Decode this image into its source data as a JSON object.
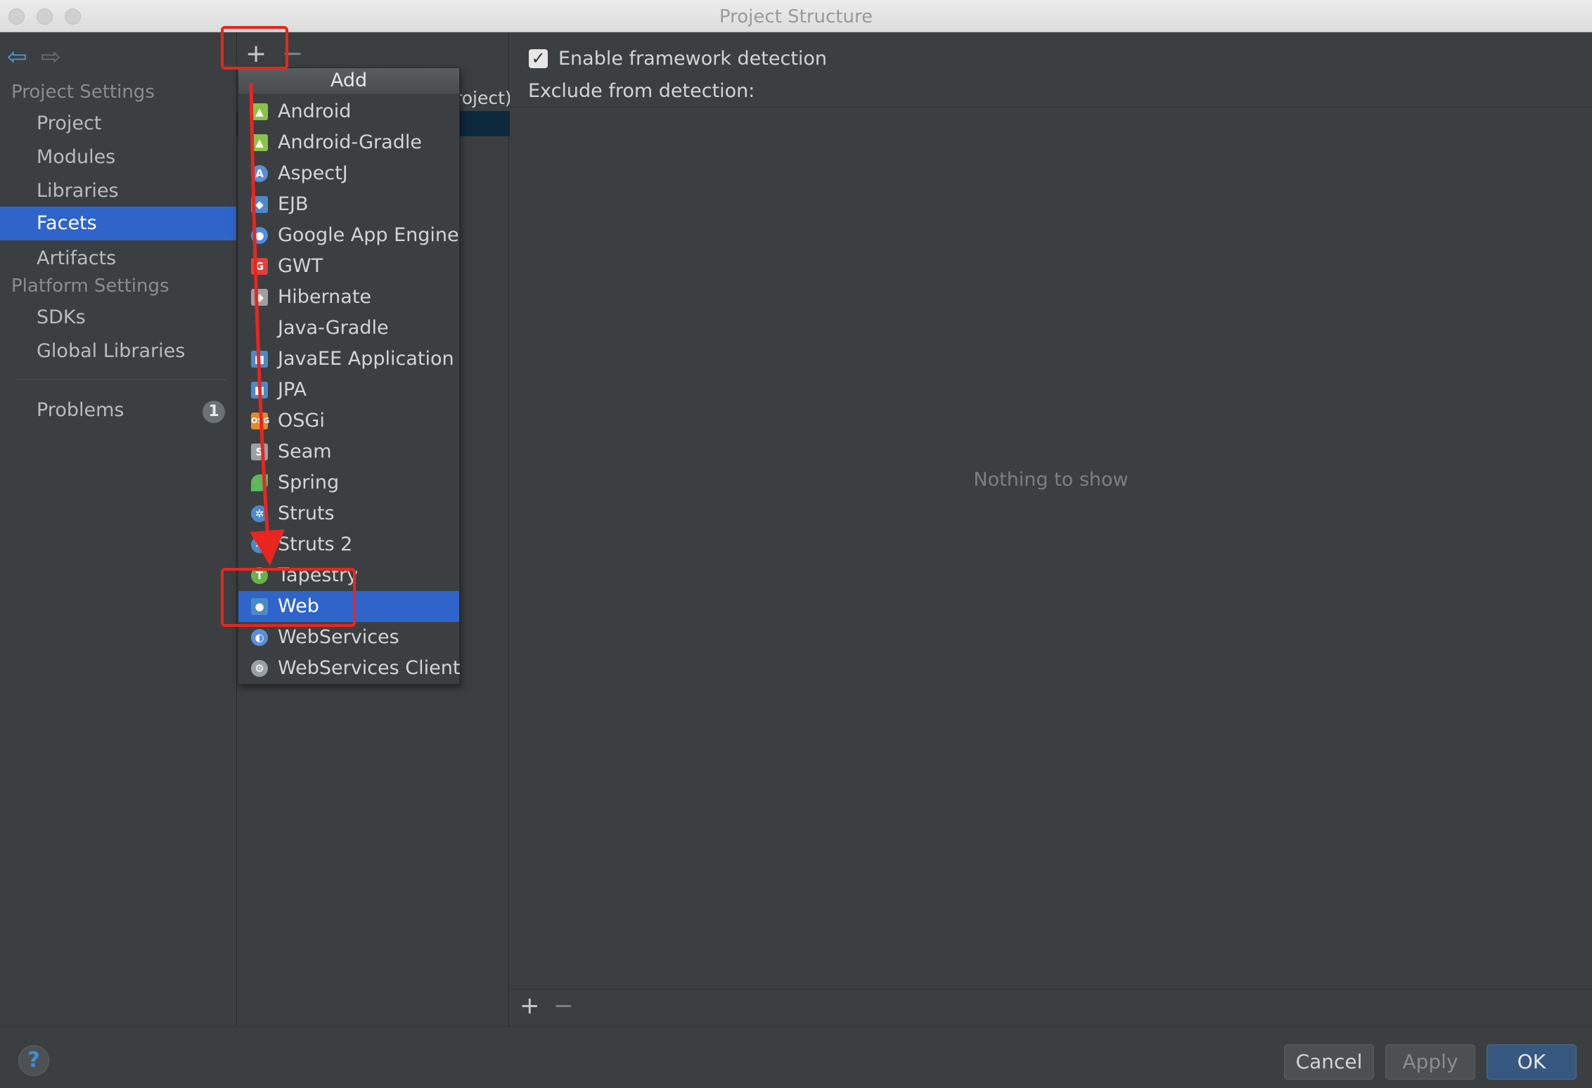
{
  "window": {
    "title": "Project Structure"
  },
  "sidebar": {
    "project_settings_header": "Project Settings",
    "platform_settings_header": "Platform Settings",
    "items": [
      {
        "label": "Project"
      },
      {
        "label": "Modules"
      },
      {
        "label": "Libraries"
      },
      {
        "label": "Facets"
      },
      {
        "label": "Artifacts"
      },
      {
        "label": "SDKs"
      },
      {
        "label": "Global Libraries"
      },
      {
        "label": "Problems"
      }
    ],
    "selected": "Facets",
    "problems_count": "1"
  },
  "middle": {
    "add_icon": "+",
    "remove_icon": "−",
    "visible_row_text": "roject)"
  },
  "popup": {
    "header": "Add",
    "items": [
      {
        "label": "Android",
        "icon": "android-icon",
        "color": "#8bc34a"
      },
      {
        "label": "Android-Gradle",
        "icon": "android-gradle-icon",
        "color": "#8bc34a"
      },
      {
        "label": "AspectJ",
        "icon": "aspectj-icon",
        "color": "#5b8fd6"
      },
      {
        "label": "EJB",
        "icon": "ejb-icon",
        "color": "#4b8ac7"
      },
      {
        "label": "Google App Engine",
        "icon": "app-engine-icon",
        "color": "#4a90e2"
      },
      {
        "label": "GWT",
        "icon": "gwt-icon",
        "color": "#e04040"
      },
      {
        "label": "Hibernate",
        "icon": "hibernate-icon",
        "color": "#a0a0a0"
      },
      {
        "label": "Java-Gradle",
        "icon": "",
        "color": ""
      },
      {
        "label": "JavaEE Application",
        "icon": "javaee-icon",
        "color": "#4b8ac7"
      },
      {
        "label": "JPA",
        "icon": "jpa-icon",
        "color": "#4b8ac7"
      },
      {
        "label": "OSGi",
        "icon": "osgi-icon",
        "color": "#e08a30"
      },
      {
        "label": "Seam",
        "icon": "seam-icon",
        "color": "#9aa0a6"
      },
      {
        "label": "Spring",
        "icon": "spring-icon",
        "color": "#5cb85c"
      },
      {
        "label": "Struts",
        "icon": "struts-icon",
        "color": "#4b8ac7"
      },
      {
        "label": "Struts 2",
        "icon": "struts2-icon",
        "color": "#4b8ac7"
      },
      {
        "label": "Tapestry",
        "icon": "tapestry-icon",
        "color": "#6ab04c"
      },
      {
        "label": "Web",
        "icon": "web-icon",
        "color": "#4b8ac7"
      },
      {
        "label": "WebServices",
        "icon": "webservices-icon",
        "color": "#5b8fd6"
      },
      {
        "label": "WebServices Client",
        "icon": "webservices-client-icon",
        "color": "#9aa0a6"
      }
    ],
    "selected": "Web"
  },
  "right": {
    "enable_detection_label": "Enable framework detection",
    "enable_detection_checked": true,
    "exclude_label": "Exclude from detection:",
    "empty_text": "Nothing to show",
    "add_icon": "+",
    "remove_icon": "−"
  },
  "footer": {
    "help_label": "?",
    "cancel_label": "Cancel",
    "apply_label": "Apply",
    "ok_label": "OK"
  },
  "colors": {
    "selection": "#2f65ca",
    "annotation": "#e8261f",
    "background": "#3c3f41"
  }
}
